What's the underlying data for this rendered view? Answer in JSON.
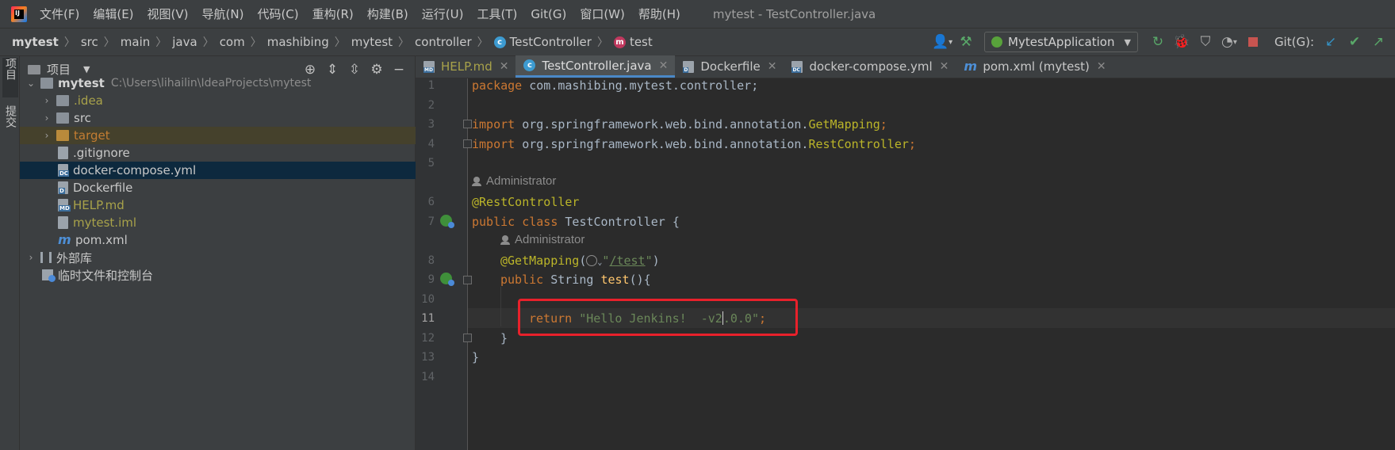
{
  "menubar": {
    "items": [
      "文件(F)",
      "编辑(E)",
      "视图(V)",
      "导航(N)",
      "代码(C)",
      "重构(R)",
      "构建(B)",
      "运行(U)",
      "工具(T)",
      "Git(G)",
      "窗口(W)",
      "帮助(H)"
    ],
    "window_title": "mytest - TestController.java"
  },
  "breadcrumb": {
    "items": [
      "mytest",
      "src",
      "main",
      "java",
      "com",
      "mashibing",
      "mytest",
      "controller"
    ],
    "class_item": "TestController",
    "method_item": "test"
  },
  "toolbar": {
    "run_config": "MytestApplication",
    "git_label": "Git(G):"
  },
  "left_strip": {
    "project_tab": "项目",
    "commit_tab": "提交"
  },
  "project_panel": {
    "title": "项目",
    "tree": [
      {
        "name": "mytest",
        "path": "C:\\Users\\lihailin\\IdeaProjects\\mytest"
      },
      {
        "name": ".idea"
      },
      {
        "name": "src"
      },
      {
        "name": "target"
      },
      {
        "name": ".gitignore"
      },
      {
        "name": "docker-compose.yml",
        "selected": true
      },
      {
        "name": "Dockerfile"
      },
      {
        "name": "HELP.md"
      },
      {
        "name": "mytest.iml"
      },
      {
        "name": "pom.xml"
      },
      {
        "name": "外部库"
      },
      {
        "name": "临时文件和控制台"
      }
    ]
  },
  "editor_tabs": [
    {
      "label": "HELP.md"
    },
    {
      "label": "TestController.java",
      "active": true
    },
    {
      "label": "Dockerfile"
    },
    {
      "label": "docker-compose.yml"
    },
    {
      "label": "pom.xml (mytest)"
    }
  ],
  "editor": {
    "line_numbers": [
      "1",
      "2",
      "3",
      "4",
      "5",
      "6",
      "7",
      "8",
      "9",
      "10",
      "11",
      "12",
      "13",
      "14"
    ],
    "author": "Administrator",
    "code": {
      "l1_kw": "package",
      "l1_rest": " com.mashibing.mytest.controller;",
      "l3_kw": "import",
      "l3_pkg": " org.springframework.web.bind.annotation.",
      "l3_cls": "GetMapping",
      "l4_kw": "import",
      "l4_pkg": " org.springframework.web.bind.annotation.",
      "l4_cls": "RestController",
      "l6_ann": "@RestController",
      "l7_kw": "public class",
      "l7_rest": " TestController {",
      "l8_ann": "@GetMapping",
      "l8_open": "(",
      "l8_q1": "\"",
      "l8_path": "/test",
      "l8_q2": "\"",
      "l8_close": ")",
      "l9_kw": "public",
      "l9_type": " String ",
      "l9_fn": "test",
      "l9_rest": "(){",
      "l11_kw": "return",
      "l11_str_a": " \"Hello Jenkins!  -v2",
      "l11_str_b": ".0.0\"",
      "l11_semi": ";",
      "l12": "}",
      "l13": "}"
    }
  },
  "colors": {
    "keyword": "#cc7832",
    "annotation": "#bbb529",
    "string": "#6a8759",
    "method": "#ffc66d",
    "highlight_box": "#e8212b"
  }
}
